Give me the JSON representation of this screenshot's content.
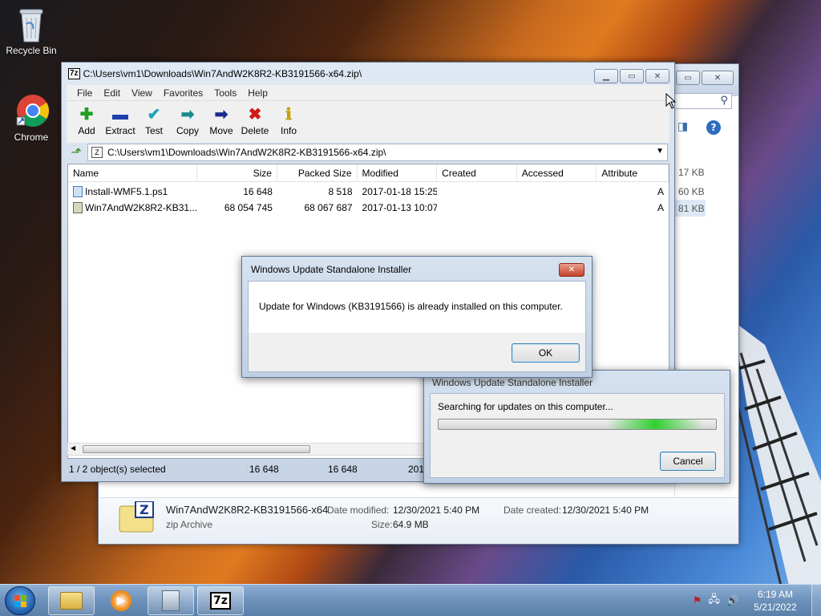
{
  "desktop": {
    "icons": [
      {
        "label": "Recycle Bin",
        "icon": "recycle-bin-icon"
      },
      {
        "label": "Chrome",
        "icon": "chrome-icon"
      }
    ]
  },
  "explorer": {
    "file_name": "Win7AndW2K8R2-KB3191566-x64",
    "file_type": "zip Archive",
    "date_modified_label": "Date modified:",
    "date_modified": "12/30/2021 5:40 PM",
    "date_created_label": "Date created:",
    "date_created": "12/30/2021 5:40 PM",
    "size_label": "Size:",
    "size": "64.9 MB",
    "partial_sizes": [
      "17 KB",
      "60 KB",
      "81 KB"
    ]
  },
  "sevenzip": {
    "title": "C:\\Users\\vm1\\Downloads\\Win7AndW2K8R2-KB3191566-x64.zip\\",
    "app_icon": "7z",
    "menu": [
      "File",
      "Edit",
      "View",
      "Favorites",
      "Tools",
      "Help"
    ],
    "toolbar": [
      {
        "label": "Add",
        "glyph": "✚",
        "color": "#1f9e1f"
      },
      {
        "label": "Extract",
        "glyph": "▬",
        "color": "#1e3fae"
      },
      {
        "label": "Test",
        "glyph": "✔",
        "color": "#1aa3b8"
      },
      {
        "label": "Copy",
        "glyph": "➡",
        "color": "#1b8a8a"
      },
      {
        "label": "Move",
        "glyph": "➡",
        "color": "#1a2a8e"
      },
      {
        "label": "Delete",
        "glyph": "✖",
        "color": "#d01818"
      },
      {
        "label": "Info",
        "glyph": "ℹ",
        "color": "#c8a000"
      }
    ],
    "address": "C:\\Users\\vm1\\Downloads\\Win7AndW2K8R2-KB3191566-x64.zip\\",
    "columns": [
      "Name",
      "Size",
      "Packed Size",
      "Modified",
      "Created",
      "Accessed",
      "Attribute"
    ],
    "rows": [
      {
        "name": "Install-WMF5.1.ps1",
        "size": "16 648",
        "packed": "8 518",
        "modified": "2017-01-18 15:25",
        "created": "",
        "accessed": "",
        "attr": "A"
      },
      {
        "name": "Win7AndW2K8R2-KB31...",
        "size": "68 054 745",
        "packed": "68 067 687",
        "modified": "2017-01-13 10:07",
        "created": "",
        "accessed": "",
        "attr": "A"
      }
    ],
    "status": {
      "selected": "1 / 2 object(s) selected",
      "size": "16 648",
      "packed": "16 648",
      "date": "2017"
    }
  },
  "dialog_installed": {
    "title": "Windows Update Standalone Installer",
    "message": "Update for Windows (KB3191566) is already installed on this computer.",
    "ok_label": "OK"
  },
  "dialog_search": {
    "title": "Windows Update Standalone Installer",
    "message": "Searching for updates on this computer...",
    "cancel_label": "Cancel"
  },
  "taskbar": {
    "time": "6:19 AM",
    "date": "5/21/2022",
    "pinned": [
      "start-orb-icon",
      "folder-icon",
      "media-player-icon",
      "installer-icon",
      "7zip-icon"
    ]
  }
}
